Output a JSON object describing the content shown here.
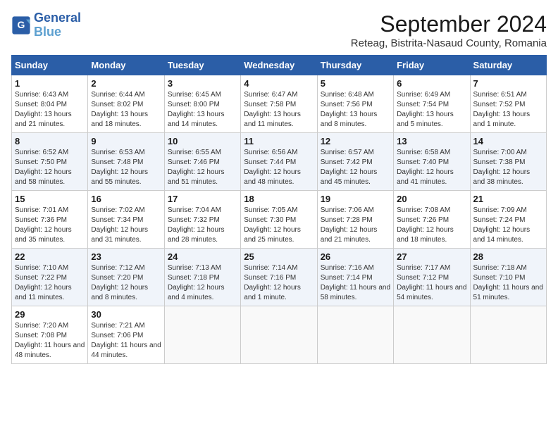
{
  "header": {
    "logo_line1": "General",
    "logo_line2": "Blue",
    "title": "September 2024",
    "subtitle": "Reteag, Bistrita-Nasaud County, Romania"
  },
  "weekdays": [
    "Sunday",
    "Monday",
    "Tuesday",
    "Wednesday",
    "Thursday",
    "Friday",
    "Saturday"
  ],
  "weeks": [
    [
      {
        "day": "1",
        "sunrise": "6:43 AM",
        "sunset": "8:04 PM",
        "daylight": "13 hours and 21 minutes."
      },
      {
        "day": "2",
        "sunrise": "6:44 AM",
        "sunset": "8:02 PM",
        "daylight": "13 hours and 18 minutes."
      },
      {
        "day": "3",
        "sunrise": "6:45 AM",
        "sunset": "8:00 PM",
        "daylight": "13 hours and 14 minutes."
      },
      {
        "day": "4",
        "sunrise": "6:47 AM",
        "sunset": "7:58 PM",
        "daylight": "13 hours and 11 minutes."
      },
      {
        "day": "5",
        "sunrise": "6:48 AM",
        "sunset": "7:56 PM",
        "daylight": "13 hours and 8 minutes."
      },
      {
        "day": "6",
        "sunrise": "6:49 AM",
        "sunset": "7:54 PM",
        "daylight": "13 hours and 5 minutes."
      },
      {
        "day": "7",
        "sunrise": "6:51 AM",
        "sunset": "7:52 PM",
        "daylight": "13 hours and 1 minute."
      }
    ],
    [
      {
        "day": "8",
        "sunrise": "6:52 AM",
        "sunset": "7:50 PM",
        "daylight": "12 hours and 58 minutes."
      },
      {
        "day": "9",
        "sunrise": "6:53 AM",
        "sunset": "7:48 PM",
        "daylight": "12 hours and 55 minutes."
      },
      {
        "day": "10",
        "sunrise": "6:55 AM",
        "sunset": "7:46 PM",
        "daylight": "12 hours and 51 minutes."
      },
      {
        "day": "11",
        "sunrise": "6:56 AM",
        "sunset": "7:44 PM",
        "daylight": "12 hours and 48 minutes."
      },
      {
        "day": "12",
        "sunrise": "6:57 AM",
        "sunset": "7:42 PM",
        "daylight": "12 hours and 45 minutes."
      },
      {
        "day": "13",
        "sunrise": "6:58 AM",
        "sunset": "7:40 PM",
        "daylight": "12 hours and 41 minutes."
      },
      {
        "day": "14",
        "sunrise": "7:00 AM",
        "sunset": "7:38 PM",
        "daylight": "12 hours and 38 minutes."
      }
    ],
    [
      {
        "day": "15",
        "sunrise": "7:01 AM",
        "sunset": "7:36 PM",
        "daylight": "12 hours and 35 minutes."
      },
      {
        "day": "16",
        "sunrise": "7:02 AM",
        "sunset": "7:34 PM",
        "daylight": "12 hours and 31 minutes."
      },
      {
        "day": "17",
        "sunrise": "7:04 AM",
        "sunset": "7:32 PM",
        "daylight": "12 hours and 28 minutes."
      },
      {
        "day": "18",
        "sunrise": "7:05 AM",
        "sunset": "7:30 PM",
        "daylight": "12 hours and 25 minutes."
      },
      {
        "day": "19",
        "sunrise": "7:06 AM",
        "sunset": "7:28 PM",
        "daylight": "12 hours and 21 minutes."
      },
      {
        "day": "20",
        "sunrise": "7:08 AM",
        "sunset": "7:26 PM",
        "daylight": "12 hours and 18 minutes."
      },
      {
        "day": "21",
        "sunrise": "7:09 AM",
        "sunset": "7:24 PM",
        "daylight": "12 hours and 14 minutes."
      }
    ],
    [
      {
        "day": "22",
        "sunrise": "7:10 AM",
        "sunset": "7:22 PM",
        "daylight": "12 hours and 11 minutes."
      },
      {
        "day": "23",
        "sunrise": "7:12 AM",
        "sunset": "7:20 PM",
        "daylight": "12 hours and 8 minutes."
      },
      {
        "day": "24",
        "sunrise": "7:13 AM",
        "sunset": "7:18 PM",
        "daylight": "12 hours and 4 minutes."
      },
      {
        "day": "25",
        "sunrise": "7:14 AM",
        "sunset": "7:16 PM",
        "daylight": "12 hours and 1 minute."
      },
      {
        "day": "26",
        "sunrise": "7:16 AM",
        "sunset": "7:14 PM",
        "daylight": "11 hours and 58 minutes."
      },
      {
        "day": "27",
        "sunrise": "7:17 AM",
        "sunset": "7:12 PM",
        "daylight": "11 hours and 54 minutes."
      },
      {
        "day": "28",
        "sunrise": "7:18 AM",
        "sunset": "7:10 PM",
        "daylight": "11 hours and 51 minutes."
      }
    ],
    [
      {
        "day": "29",
        "sunrise": "7:20 AM",
        "sunset": "7:08 PM",
        "daylight": "11 hours and 48 minutes."
      },
      {
        "day": "30",
        "sunrise": "7:21 AM",
        "sunset": "7:06 PM",
        "daylight": "11 hours and 44 minutes."
      },
      null,
      null,
      null,
      null,
      null
    ]
  ]
}
